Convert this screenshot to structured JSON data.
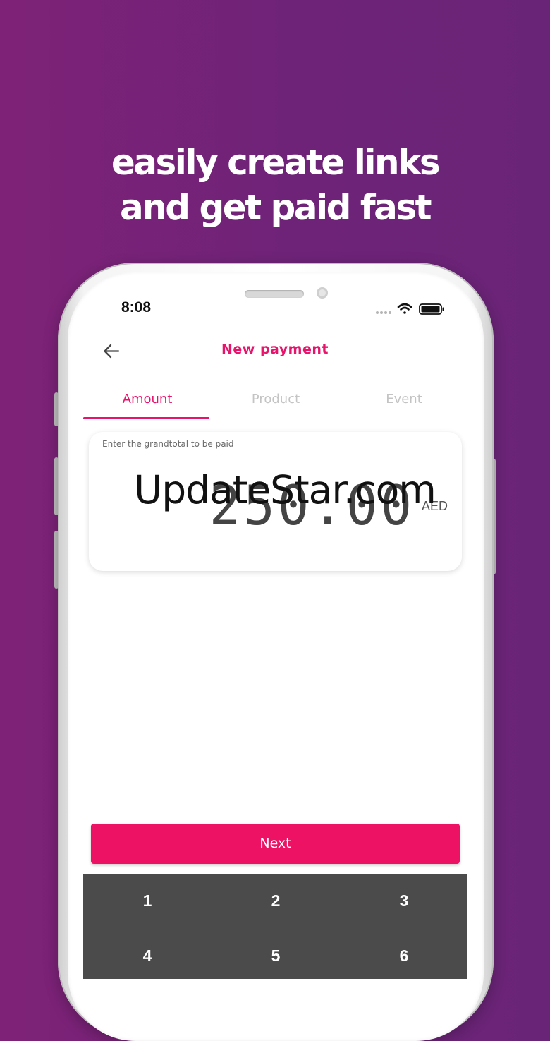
{
  "promo": {
    "line1": "easily create links",
    "line2": "and get paid fast"
  },
  "status_bar": {
    "time": "8:08",
    "icons": [
      "signal-dots-icon",
      "wifi-icon",
      "battery-icon"
    ]
  },
  "header": {
    "back_icon": "arrow-left-icon",
    "title": "New payment"
  },
  "tabs": [
    {
      "label": "Amount",
      "active": true
    },
    {
      "label": "Product",
      "active": false
    },
    {
      "label": "Event",
      "active": false
    }
  ],
  "amount": {
    "hint": "Enter the grandtotal to be paid",
    "value": "250.00",
    "currency": "AED"
  },
  "watermark": "UpdateStar.com",
  "next_button": "Next",
  "keypad": {
    "keys": [
      "1",
      "2",
      "3",
      "4",
      "5",
      "6"
    ]
  },
  "colors": {
    "accent": "#e8136b",
    "button": "#ed1264",
    "background": "#72237a",
    "keypad": "#4b4b4b"
  }
}
